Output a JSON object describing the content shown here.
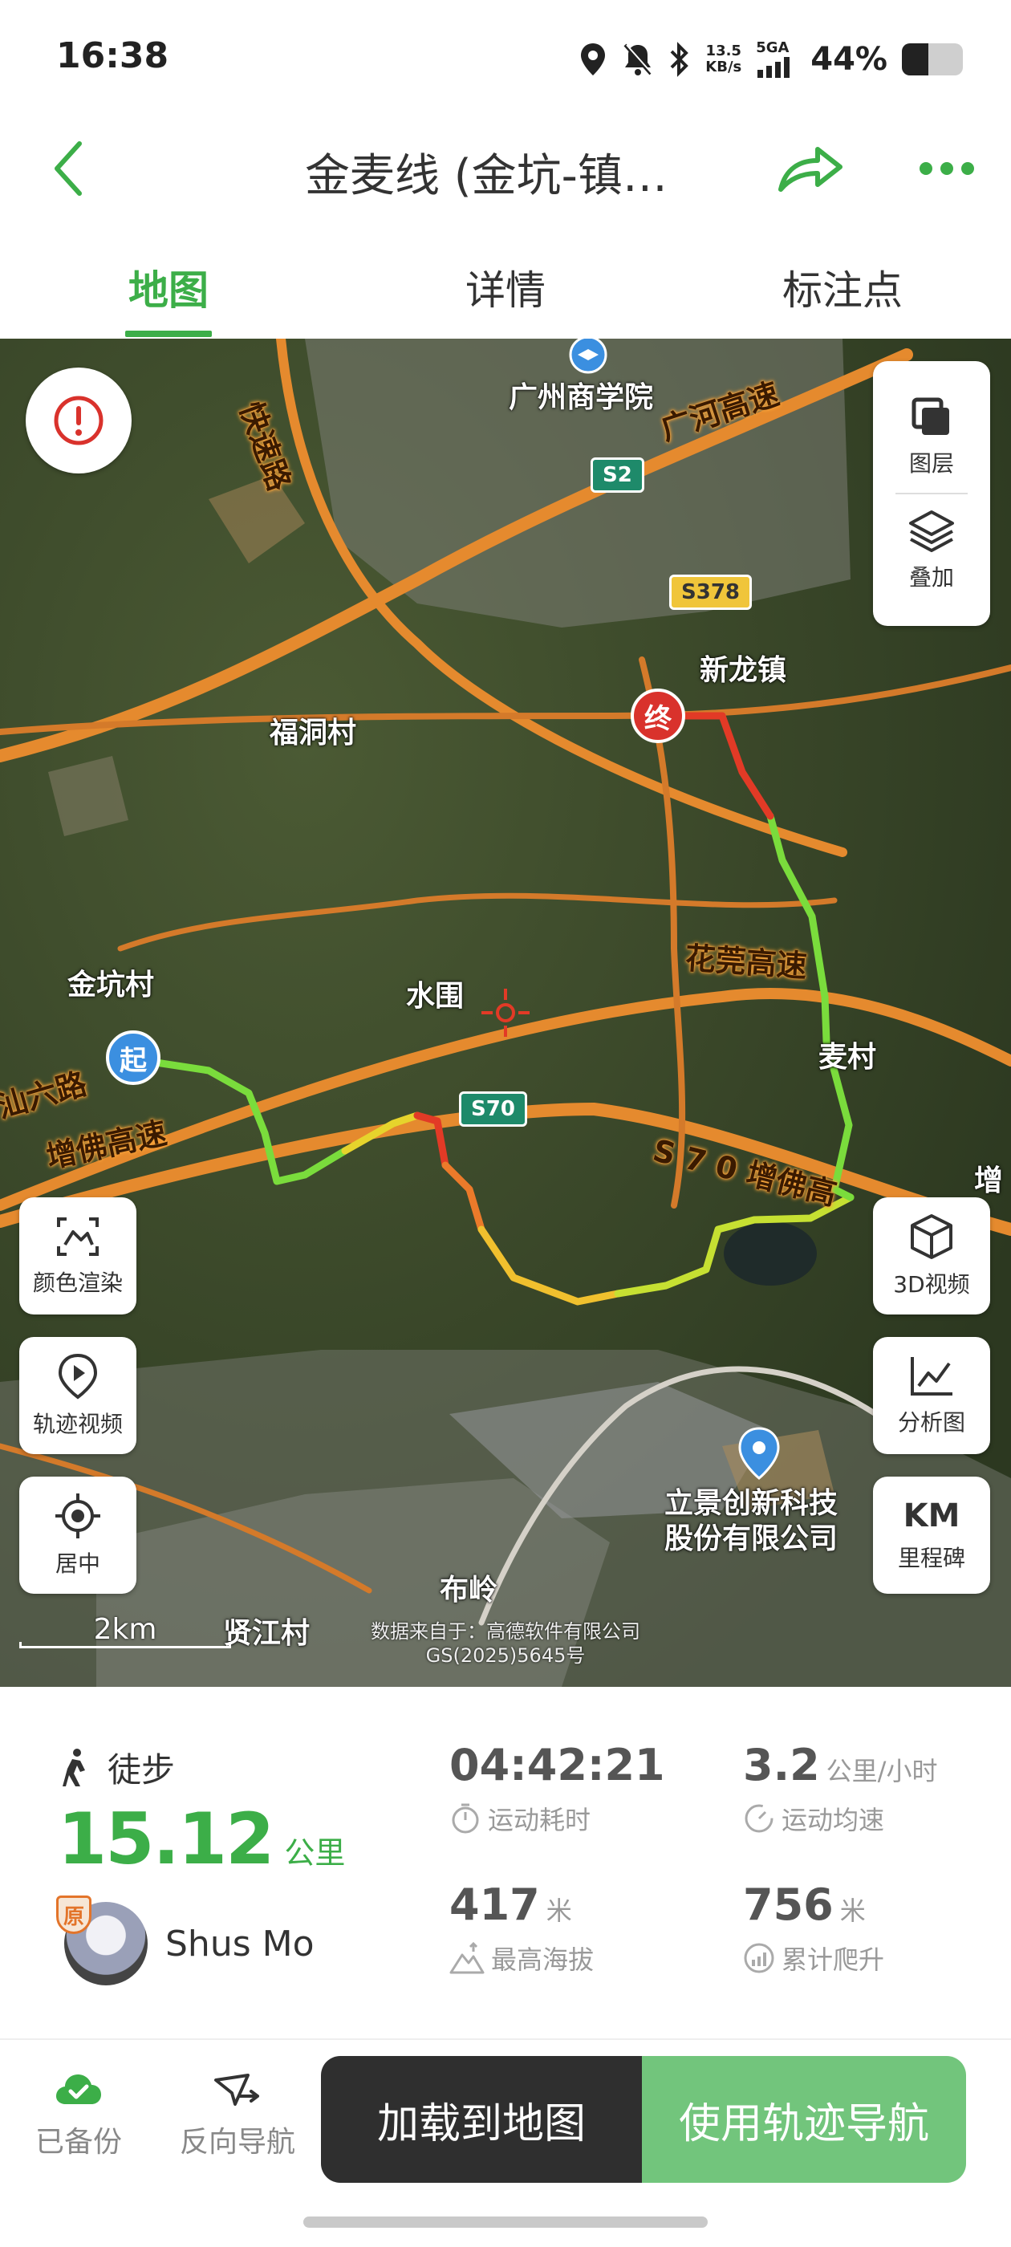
{
  "status_bar": {
    "time": "16:38",
    "net_speed_value": "13.5",
    "net_speed_unit": "KB/s",
    "network": "5GA",
    "battery_pct": "44%",
    "battery_level": 0.44,
    "icons": [
      "location-icon",
      "mute-bell-icon",
      "bluetooth-icon",
      "signal-icon",
      "battery-icon"
    ]
  },
  "header": {
    "title": "金麦线 (金坑-镇…",
    "back_icon": "chevron-left-icon",
    "share_icon": "share-arrow-icon",
    "more_icon": "more-dots-icon"
  },
  "tabs": [
    {
      "label": "地图",
      "active": true
    },
    {
      "label": "详情",
      "active": false
    },
    {
      "label": "标注点",
      "active": false
    }
  ],
  "map": {
    "layer_buttons": [
      {
        "label": "图层",
        "icon": "layers-square-icon"
      },
      {
        "label": "叠加",
        "icon": "stack-overlay-icon"
      }
    ],
    "left_controls": [
      {
        "label": "颜色渲染",
        "icon": "color-render-icon"
      },
      {
        "label": "轨迹视频",
        "icon": "track-video-icon"
      },
      {
        "label": "居中",
        "icon": "center-target-icon"
      }
    ],
    "right_controls": [
      {
        "label": "3D视频",
        "icon": "cube-3d-icon"
      },
      {
        "label": "分析图",
        "icon": "line-chart-icon"
      },
      {
        "label": "里程碑",
        "icon_text": "KM"
      }
    ],
    "place_labels": {
      "school": "广州商学院",
      "xinlong": "新龙镇",
      "fudong": "福洞村",
      "jinkeng": "金坑村",
      "shuiwei": "水围",
      "maicun": "麦村",
      "company_line1": "立景创新科技",
      "company_line2": "股份有限公司",
      "buling": "布岭",
      "xianjiang": "贤江村",
      "zeng_edge": "增"
    },
    "road_labels": {
      "guanghe": "广河高速",
      "kuaisu": "快速路",
      "huaguan": "花莞高速",
      "zengfo": "增佛高速",
      "s70_zengfo": "S 7 0 增佛高",
      "shanliu": "汕六路"
    },
    "shields": {
      "s2": "S2",
      "s378": "S378",
      "s70": "S70"
    },
    "start_marker": "起",
    "end_marker": "终",
    "scale": "2km",
    "copyright_line1": "数据来自于：高德软件有限公司",
    "copyright_line2": "GS(2025)5645号"
  },
  "stats": {
    "sport_type": "徒步",
    "distance_value": "15.12",
    "distance_unit": "公里",
    "user_name": "Shus Mo",
    "original_badge": "原",
    "duration_value": "04:42:21",
    "duration_label": "运动耗时",
    "avg_speed_value": "3.2",
    "avg_speed_unit": "公里/小时",
    "avg_speed_label": "运动均速",
    "max_alt_value": "417",
    "max_alt_unit": "米",
    "max_alt_label": "最高海拔",
    "climb_value": "756",
    "climb_unit": "米",
    "climb_label": "累计爬升"
  },
  "bottom_bar": {
    "backup_label": "已备份",
    "reverse_label": "反向导航",
    "load_label": "加载到地图",
    "navigate_label": "使用轨迹导航"
  },
  "colors": {
    "accent": "#3cae48",
    "nav_button": "#72c57c",
    "load_button": "#2f2f2f",
    "start_marker": "#3b8fe0",
    "end_marker": "#d9322c"
  }
}
